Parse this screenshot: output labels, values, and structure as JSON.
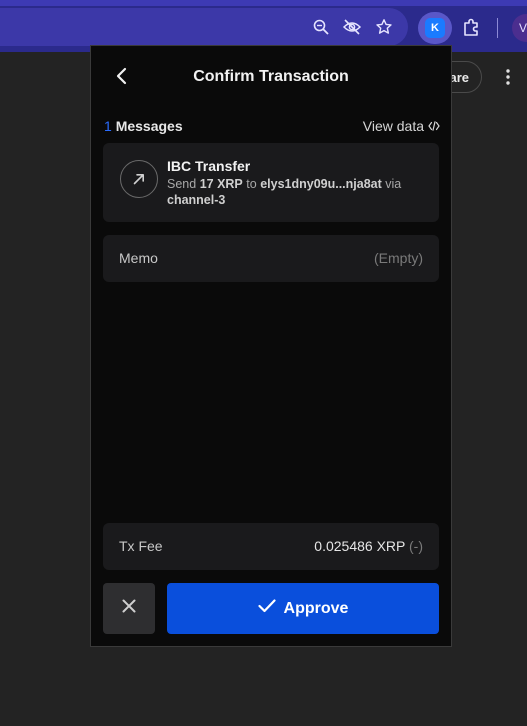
{
  "browser": {
    "toolbar_icons": [
      "zoom-icon",
      "eye-off-icon",
      "star-icon",
      "extension-k-icon",
      "puzzle-icon"
    ],
    "extension_letter": "K",
    "profile_initial": "V"
  },
  "background_page": {
    "share_label": "are"
  },
  "popup": {
    "title": "Confirm Transaction",
    "messages": {
      "count": "1",
      "label": "Messages",
      "view_data_label": "View data"
    },
    "transaction": {
      "title": "IBC Transfer",
      "desc_send": "Send",
      "amount": "17 XRP",
      "desc_to": "to",
      "recipient": "elys1dny09u...nja8at",
      "desc_via": "via",
      "channel": "channel-3"
    },
    "memo": {
      "label": "Memo",
      "value": "(Empty)"
    },
    "fee": {
      "label": "Tx Fee",
      "value": "0.025486 XRP",
      "suffix": "(-)"
    },
    "buttons": {
      "approve_label": "Approve"
    }
  },
  "colors": {
    "accent": "#0a4fdc",
    "browser_bar": "#2b2a8c",
    "popup_bg": "#0a0a0a",
    "card_bg": "#1a1a1c"
  }
}
